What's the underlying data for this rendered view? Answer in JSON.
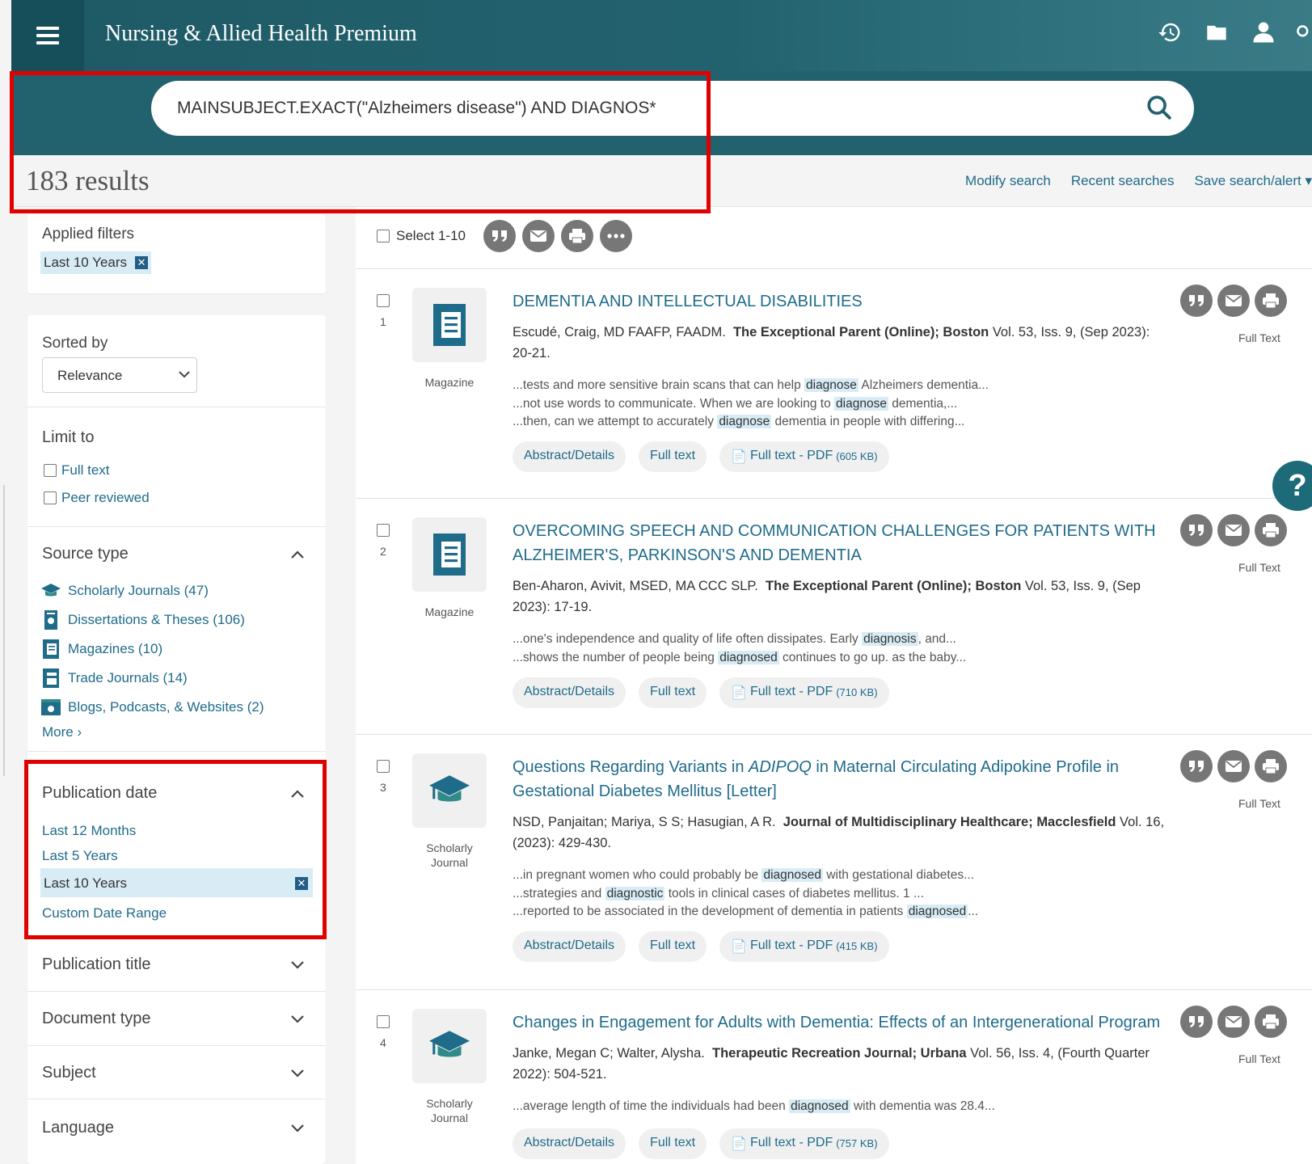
{
  "header": {
    "title": "Nursing & Allied Health Premium"
  },
  "search": {
    "query": "MAINSUBJECT.EXACT(\"Alzheimers disease\") AND DIAGNOS*"
  },
  "results_bar": {
    "count": "183 results",
    "modify": "Modify search",
    "recent": "Recent searches",
    "save": "Save search/alert ▾"
  },
  "applied_filters": {
    "title": "Applied filters",
    "chip": "Last 10 Years"
  },
  "sort": {
    "title": "Sorted by",
    "value": "Relevance"
  },
  "limit": {
    "title": "Limit to",
    "options": [
      "Full text",
      "Peer reviewed"
    ]
  },
  "source_type": {
    "title": "Source type",
    "items": [
      {
        "label": "Scholarly Journals (47)",
        "icon": "graduation-cap"
      },
      {
        "label": "Dissertations & Theses (106)",
        "icon": "dissertation"
      },
      {
        "label": "Magazines (10)",
        "icon": "magazine"
      },
      {
        "label": "Trade Journals (14)",
        "icon": "trade-journal"
      },
      {
        "label": "Blogs, Podcasts, & Websites (2)",
        "icon": "website"
      }
    ],
    "more": "More ›"
  },
  "pub_date": {
    "title": "Publication date",
    "options": [
      "Last 12 Months",
      "Last 5 Years"
    ],
    "selected": "Last 10 Years",
    "custom": "Custom Date Range"
  },
  "collapsed_sections": [
    "Publication title",
    "Document type",
    "Subject",
    "Language"
  ],
  "results_toolbar": {
    "select_label": "Select 1-10"
  },
  "records": [
    {
      "num": "1",
      "type": "Magazine",
      "title": "DEMENTIA AND INTELLECTUAL DISABILITIES",
      "authors": "Escudé, Craig, MD FAAFP, FAADM.",
      "source": "The Exceptional Parent (Online); Boston",
      "details": "Vol. 53, Iss. 9,  (Sep 2023): 20-21.",
      "snippets": [
        {
          "pre": "...tests and more sensitive brain scans that can help ",
          "hl": "diagnose",
          "post": " Alzheimers dementia..."
        },
        {
          "pre": "...not use words to communicate. When we are looking to ",
          "hl": "diagnose",
          "post": " dementia,..."
        },
        {
          "pre": "...then, can we attempt to accurately ",
          "hl": "diagnose",
          "post": " dementia in people with differing..."
        }
      ],
      "pdf_size": "(605 KB)"
    },
    {
      "num": "2",
      "type": "Magazine",
      "title": "OVERCOMING SPEECH AND COMMUNICATION CHALLENGES FOR PATIENTS WITH ALZHEIMER'S, PARKINSON'S AND DEMENTIA",
      "authors": "Ben-Aharon, Avivit, MSED, MA CCC SLP.",
      "source": "The Exceptional Parent (Online); Boston",
      "details": "Vol. 53, Iss. 9,  (Sep 2023): 17-19.",
      "snippets": [
        {
          "pre": "...one's independence and quality of life often dissipates. Early ",
          "hl": "diagnosis",
          "post": ", and..."
        },
        {
          "pre": "...shows the number of people being ",
          "hl": "diagnosed",
          "post": " continues to go up. as the baby..."
        }
      ],
      "pdf_size": "(710 KB)"
    },
    {
      "num": "3",
      "type": "Scholarly Journal",
      "title_pre": "Questions Regarding Variants in ",
      "title_em": "ADIPOQ",
      "title_post": " in Maternal Circulating Adipokine Profile in Gestational Diabetes Mellitus [Letter]",
      "authors": "NSD, Panjaitan; Mariya, S S; Hasugian, A R.",
      "source": "Journal of Multidisciplinary Healthcare; Macclesfield",
      "details": "Vol. 16, (2023): 429-430.",
      "snippets": [
        {
          "pre": "...in pregnant women who could probably be ",
          "hl": "diagnosed",
          "post": " with gestational diabetes..."
        },
        {
          "pre": "...strategies and ",
          "hl": "diagnostic",
          "post": " tools in clinical cases of diabetes mellitus. 1 ..."
        },
        {
          "pre": "...reported to be associated in the development of dementia in patients ",
          "hl": "diagnosed",
          "post": "..."
        }
      ],
      "pdf_size": "(415 KB)"
    },
    {
      "num": "4",
      "type": "Scholarly Journal",
      "title": "Changes in Engagement for Adults with Dementia: Effects of an Intergenerational Program",
      "authors": "Janke, Megan C; Walter, Alysha.",
      "source": "Therapeutic Recreation Journal; Urbana",
      "details": "Vol. 56, Iss. 4,  (Fourth Quarter 2022): 504-521.",
      "snippets": [
        {
          "pre": "...average length of time the individuals had been ",
          "hl": "diagnosed",
          "post": " with dementia was 28.4..."
        }
      ],
      "pdf_size": "(757 KB)"
    }
  ],
  "record_links": {
    "abstract": "Abstract/Details",
    "fulltext": "Full text",
    "pdf": "Full text - PDF",
    "fulltext_label": "Full Text"
  },
  "help": "?"
}
